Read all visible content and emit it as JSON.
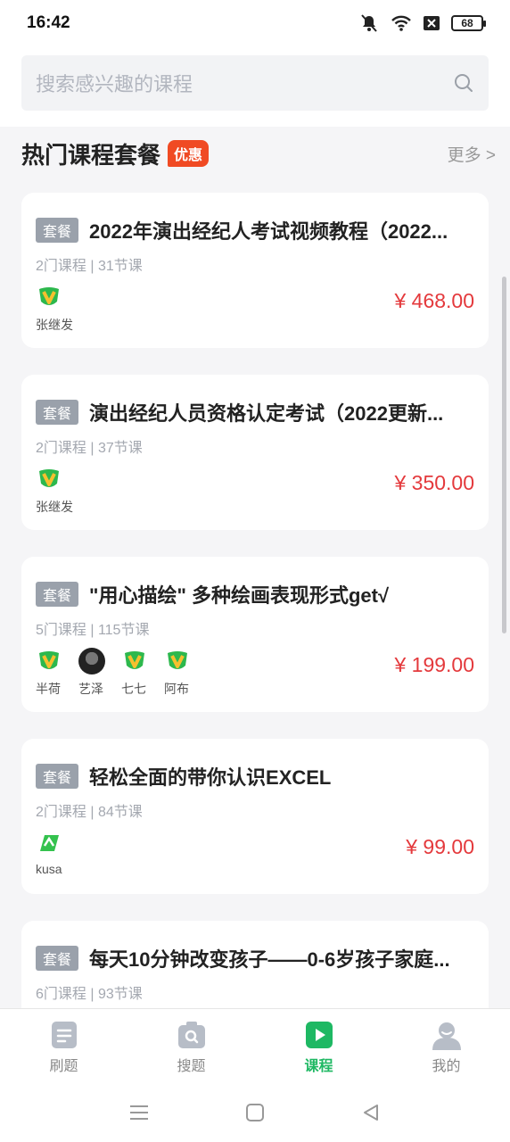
{
  "status": {
    "time": "16:42",
    "battery": "68"
  },
  "search": {
    "placeholder": "搜索感兴趣的课程"
  },
  "section": {
    "title": "热门课程套餐",
    "badge": "优惠",
    "more": "更多 >"
  },
  "cards": [
    {
      "tag": "套餐",
      "title": "2022年演出经纪人考试视频教程（2022...",
      "meta": "2门课程 | 31节课",
      "teachers": [
        {
          "name": "张继发",
          "icon": "green-shield-logo-icon"
        }
      ],
      "price": "¥ 468.00"
    },
    {
      "tag": "套餐",
      "title": "演出经纪人员资格认定考试（2022更新...",
      "meta": "2门课程 | 37节课",
      "teachers": [
        {
          "name": "张继发",
          "icon": "green-shield-logo-icon"
        }
      ],
      "price": "¥ 350.00"
    },
    {
      "tag": "套餐",
      "title": "\"用心描绘\" 多种绘画表现形式get√",
      "meta": "5门课程 | 115节课",
      "teachers": [
        {
          "name": "半荷",
          "icon": "green-shield-logo-icon"
        },
        {
          "name": "艺泽",
          "icon": "user-photo-avatar"
        },
        {
          "name": "七七",
          "icon": "green-shield-logo-icon"
        },
        {
          "name": "阿布",
          "icon": "green-shield-logo-icon"
        }
      ],
      "price": "¥ 199.00"
    },
    {
      "tag": "套餐",
      "title": "轻松全面的带你认识EXCEL",
      "meta": "2门课程 | 84节课",
      "teachers": [
        {
          "name": "kusa",
          "icon": "green-leaf-logo-icon"
        }
      ],
      "price": "¥ 99.00"
    },
    {
      "tag": "套餐",
      "title": "每天10分钟改变孩子——0-6岁孩子家庭...",
      "meta": "6门课程 | 93节课",
      "teachers": [],
      "price": ""
    }
  ],
  "tabs": [
    {
      "label": "刷题",
      "icon": "document-icon",
      "active": false
    },
    {
      "label": "搜题",
      "icon": "camera-search-icon",
      "active": false
    },
    {
      "label": "课程",
      "icon": "play-icon",
      "active": true
    },
    {
      "label": "我的",
      "icon": "user-icon",
      "active": false
    }
  ],
  "colors": {
    "accent": "#1eb863",
    "price": "#e4393c",
    "badge": "#f04a23"
  }
}
